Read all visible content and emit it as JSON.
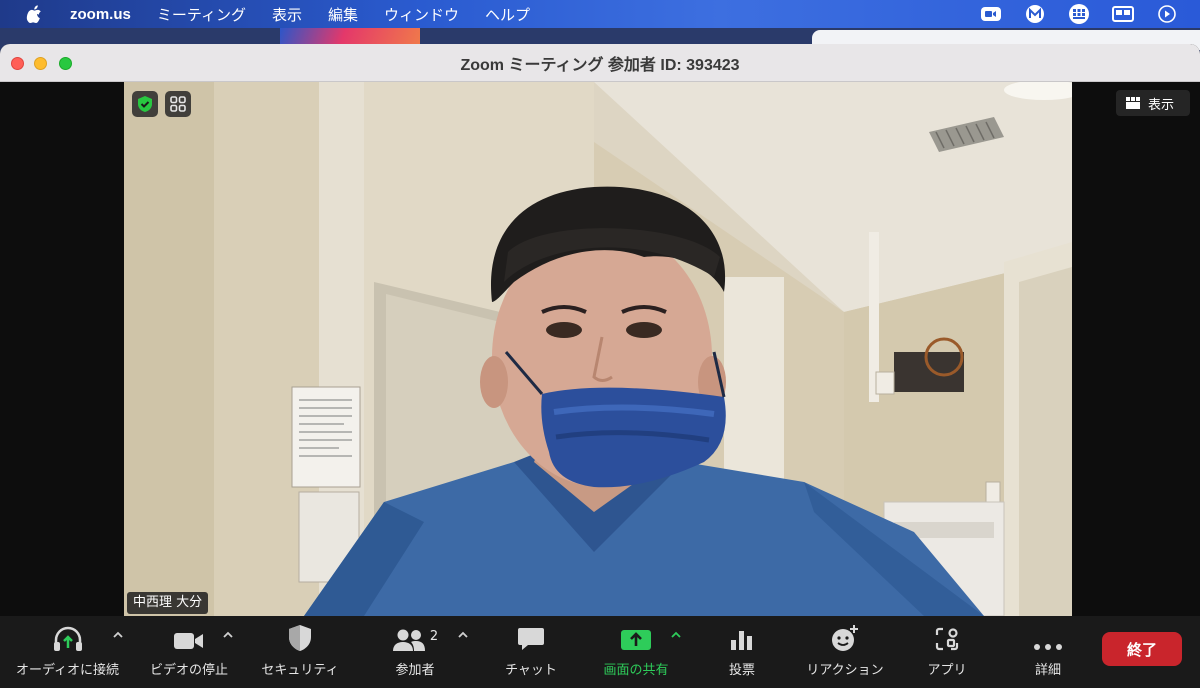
{
  "menubar": {
    "app_name": "zoom.us",
    "items": [
      "ミーティング",
      "表示",
      "編集",
      "ウィンドウ",
      "ヘルプ"
    ],
    "right_icons": [
      "zoom-video-icon",
      "m-app-icon",
      "language-grid-icon",
      "display-icon",
      "play-circle-icon"
    ]
  },
  "window": {
    "title": "Zoom ミーティング 参加者 ID: 393423"
  },
  "stage": {
    "view_button": "表示",
    "participant_name": "中西理 大分"
  },
  "toolbar": {
    "audio": "オーディオに接続",
    "video": "ビデオの停止",
    "security": "セキュリティ",
    "participants": "参加者",
    "participants_count": "2",
    "chat": "チャット",
    "share": "画面の共有",
    "polls": "投票",
    "reactions": "リアクション",
    "apps": "アプリ",
    "more": "詳細",
    "end": "終了"
  },
  "colors": {
    "share_green": "#2ecc5a",
    "end_red": "#c9252c",
    "toolbar_bg": "#1a1a1a"
  }
}
